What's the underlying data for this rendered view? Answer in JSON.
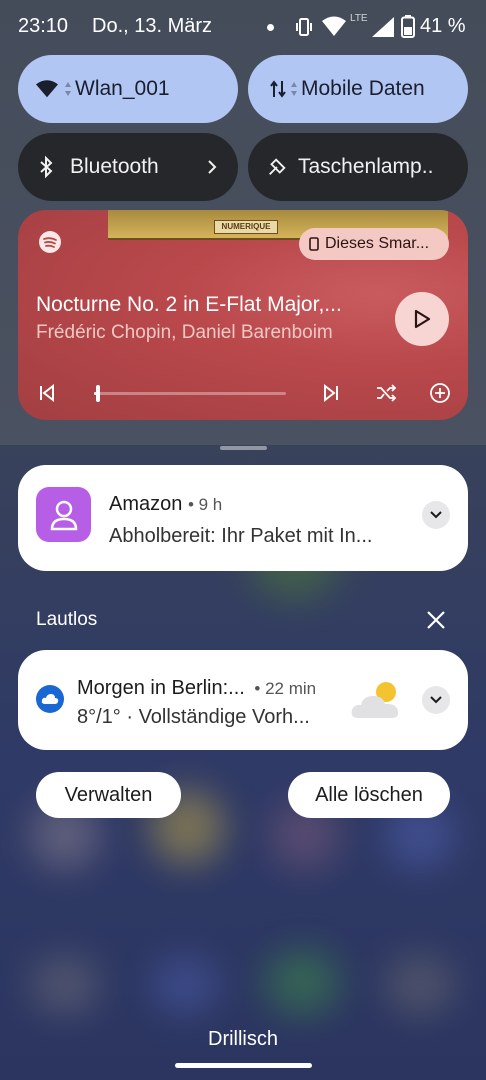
{
  "status_bar": {
    "time": "23:10",
    "date": "Do., 13. März",
    "network_type": "LTE",
    "battery": "41 %"
  },
  "quick_tiles": {
    "wifi": {
      "label": "Wlan_001",
      "state": "on"
    },
    "mobile_data": {
      "label": "Mobile Daten",
      "state": "on"
    },
    "bluetooth": {
      "label": "Bluetooth",
      "state": "off"
    },
    "flashlight": {
      "label": "Taschenlamp..",
      "state": "off"
    }
  },
  "media_player": {
    "app_icon": "spotify-icon",
    "album_art_label": "NUMERIQUE",
    "output_device": "Dieses Smar...",
    "title": "Nocturne No. 2 in E-Flat Major,...",
    "artist": "Frédéric Chopin, Daniel Barenboim",
    "progress_fraction": 0.02,
    "accent_color": "#b9484b"
  },
  "notifications": [
    {
      "app": "Amazon",
      "time": "• 9 h",
      "body": "Abholbereit: Ihr Paket mit In...",
      "icon": "amazon-user-icon",
      "icon_color": "#b65ee6"
    }
  ],
  "silent_section": {
    "label": "Lautlos",
    "notifications": [
      {
        "title": "Morgen in Berlin:...",
        "time": "• 22 min",
        "body": "8°/1° · Vollständige Vorh...",
        "icon": "cloud-icon",
        "icon_color": "#1967d2",
        "image": "partly-cloudy-icon"
      }
    ]
  },
  "actions": {
    "manage": "Verwalten",
    "clear_all": "Alle löschen"
  },
  "footer": {
    "carrier": "Drillisch"
  }
}
